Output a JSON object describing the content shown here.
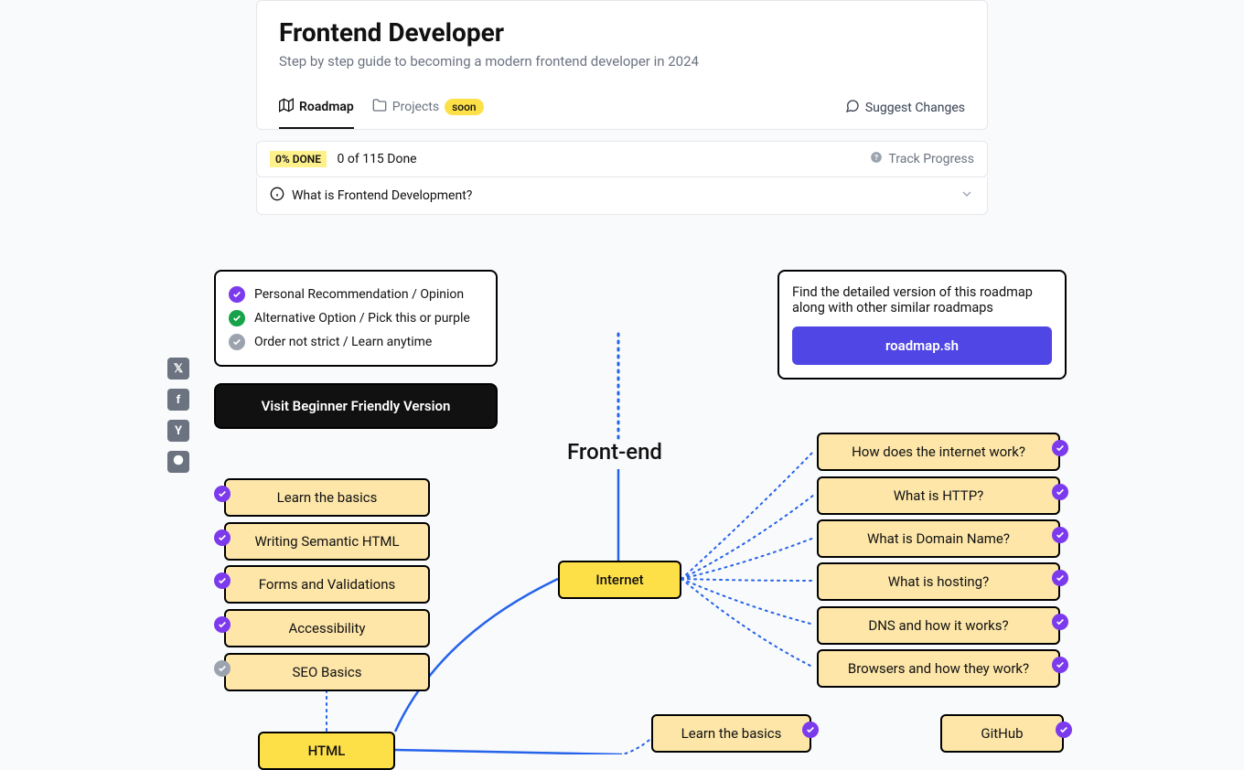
{
  "header": {
    "title": "Frontend Developer",
    "subtitle": "Step by step guide to becoming a modern frontend developer in 2024"
  },
  "tabs": {
    "roadmap": "Roadmap",
    "projects": "Projects",
    "soon_badge": "soon",
    "suggest": "Suggest Changes"
  },
  "progress": {
    "done_badge": "0% DONE",
    "done_text": "0 of 115 Done",
    "track": "Track Progress"
  },
  "info": {
    "question": "What is Frontend Development?"
  },
  "legend": {
    "purple": "Personal Recommendation / Opinion",
    "green": "Alternative Option / Pick this or purple",
    "gray": "Order not strict / Learn anytime"
  },
  "beginner_btn": "Visit Beginner Friendly Version",
  "promo": {
    "text": "Find the detailed version of this roadmap along with other similar roadmaps",
    "button": "roadmap.sh"
  },
  "root_title": "Front-end",
  "nodes": {
    "internet": "Internet",
    "html": "HTML",
    "github": "GitHub",
    "internet_topics": [
      "How does the internet work?",
      "What is HTTP?",
      "What is Domain Name?",
      "What is hosting?",
      "DNS and how it works?",
      "Browsers and how they work?"
    ],
    "html_topics": [
      "Learn the basics",
      "Writing Semantic HTML",
      "Forms and Validations",
      "Accessibility",
      "SEO Basics"
    ],
    "css_topics": [
      "Learn the basics"
    ]
  },
  "share": {
    "x": "𝕏",
    "fb": "f",
    "hn": "Y",
    "reddit": "⬬"
  }
}
